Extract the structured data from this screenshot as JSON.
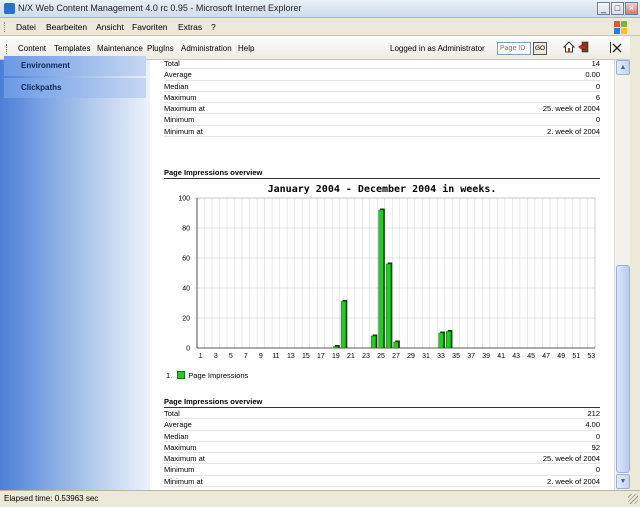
{
  "window": {
    "title": "N/X Web Content Management 4.0 rc 0.95 - Microsoft Internet Explorer",
    "buttons": {
      "minimize": "_",
      "maximize": "□",
      "close": "×"
    }
  },
  "menu": {
    "items": [
      "Datei",
      "Bearbeiten",
      "Ansicht",
      "Favoriten",
      "Extras",
      "?"
    ]
  },
  "nav": {
    "items": [
      "Content",
      "Templates",
      "Maintenance",
      "PlugIns",
      "Administration",
      "Help"
    ],
    "login_text": "Logged in as Administrator",
    "pageid_placeholder": "Page ID",
    "go_label": "GO"
  },
  "sidebar": {
    "items": [
      {
        "label": "Environment"
      },
      {
        "label": "Clickpaths"
      }
    ]
  },
  "stats_top": {
    "rows": [
      {
        "label": "Total",
        "value": "14"
      },
      {
        "label": "Average",
        "value": "0.00"
      },
      {
        "label": "Median",
        "value": "0"
      },
      {
        "label": "Maximum",
        "value": "6"
      },
      {
        "label": "Maximum at",
        "value": "25. week of 2004"
      },
      {
        "label": "Minimum",
        "value": "0"
      },
      {
        "label": "Minimum at",
        "value": "2. week of 2004"
      }
    ]
  },
  "overview": {
    "title": "Page Impressions overview"
  },
  "chart_data": {
    "type": "bar",
    "title": "January 2004   -   December 2004 in weeks.",
    "xlabel": "",
    "ylabel": "",
    "ylim": [
      0,
      100
    ],
    "y_ticks": [
      0,
      20,
      40,
      60,
      80,
      100
    ],
    "x_tick_labels": [
      "1",
      "3",
      "5",
      "7",
      "9",
      "11",
      "13",
      "15",
      "17",
      "19",
      "21",
      "23",
      "25",
      "27",
      "29",
      "31",
      "33",
      "35",
      "37",
      "39",
      "41",
      "43",
      "45",
      "47",
      "49",
      "51",
      "53"
    ],
    "grid": true,
    "legend_position": "bottom-left",
    "bar_color": "#22cc22",
    "series": [
      {
        "name": "Page Impressions",
        "weeks": [
          1,
          2,
          3,
          4,
          5,
          6,
          7,
          8,
          9,
          10,
          11,
          12,
          13,
          14,
          15,
          16,
          17,
          18,
          19,
          20,
          21,
          22,
          23,
          24,
          25,
          26,
          27,
          28,
          29,
          30,
          31,
          32,
          33,
          34,
          35,
          36,
          37,
          38,
          39,
          40,
          41,
          42,
          43,
          44,
          45,
          46,
          47,
          48,
          49,
          50,
          51,
          52,
          53
        ],
        "values": [
          0,
          0,
          0,
          0,
          0,
          0,
          0,
          0,
          0,
          0,
          0,
          0,
          0,
          0,
          0,
          0,
          0,
          0,
          1,
          31,
          0,
          0,
          0,
          8,
          92,
          56,
          4,
          0,
          0,
          0,
          0,
          0,
          10,
          11,
          0,
          0,
          0,
          0,
          0,
          0,
          0,
          0,
          0,
          0,
          0,
          0,
          0,
          0,
          0,
          0,
          0,
          0,
          0
        ]
      }
    ]
  },
  "legend": {
    "index": "1.",
    "label": "Page Impressions"
  },
  "stats_bottom": {
    "title": "Page Impressions overview",
    "rows": [
      {
        "label": "Total",
        "value": "212"
      },
      {
        "label": "Average",
        "value": "4.00"
      },
      {
        "label": "Median",
        "value": "0"
      },
      {
        "label": "Maximum",
        "value": "92"
      },
      {
        "label": "Maximum at",
        "value": "25. week of 2004"
      },
      {
        "label": "Minimum",
        "value": "0"
      },
      {
        "label": "Minimum at",
        "value": "2. week of 2004"
      }
    ]
  },
  "status": {
    "text": "Elapsed time: 0.53963 sec"
  }
}
